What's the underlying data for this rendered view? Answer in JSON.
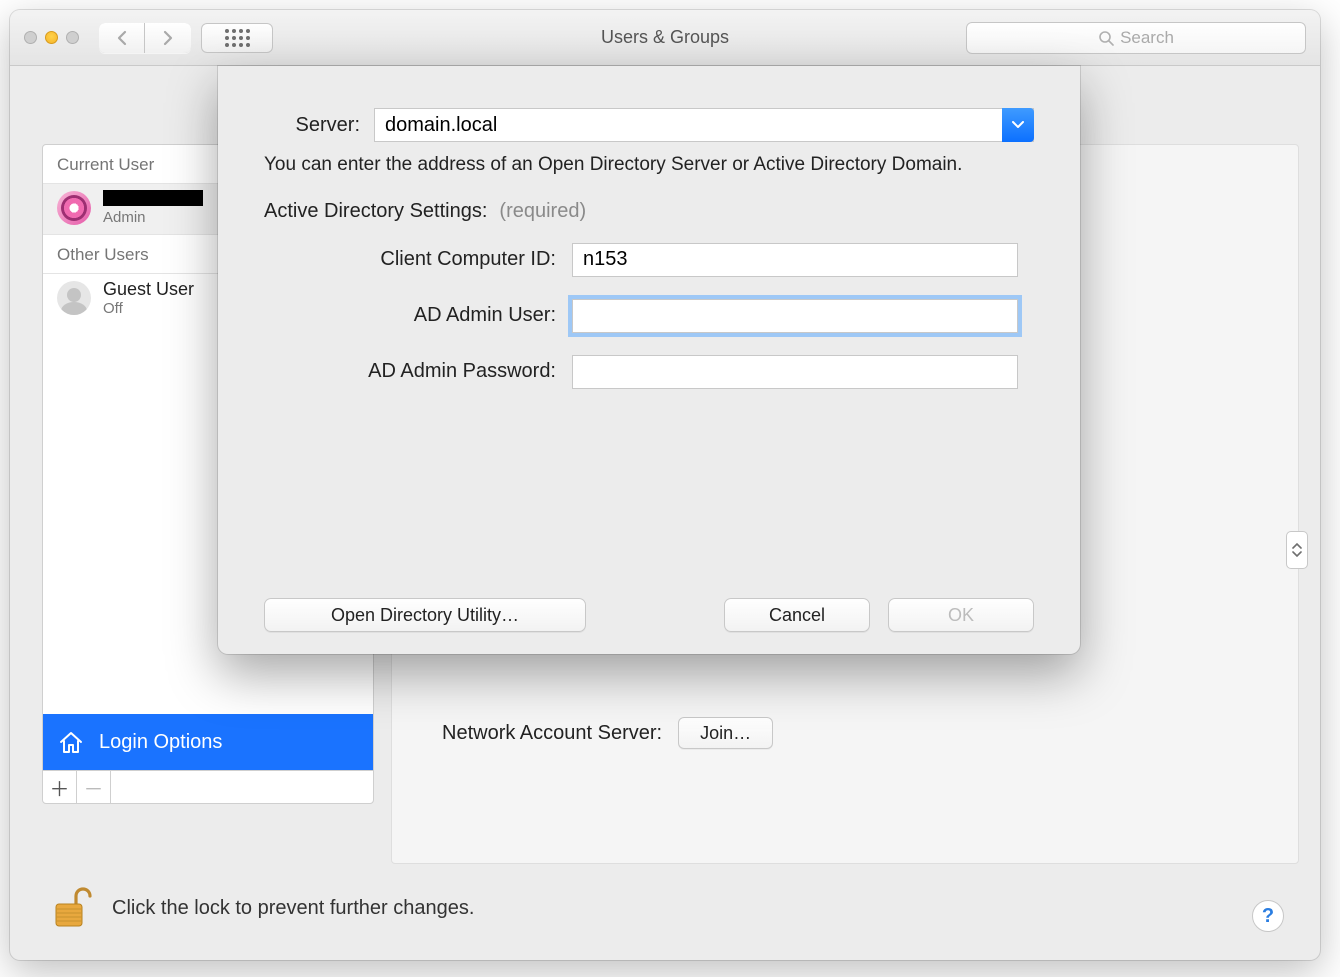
{
  "window": {
    "title": "Users & Groups"
  },
  "search": {
    "placeholder": "Search"
  },
  "sidebar": {
    "current_user_label": "Current User",
    "other_users_label": "Other Users",
    "current_role": "Admin",
    "guest_name": "Guest User",
    "guest_status": "Off",
    "login_options": "Login Options"
  },
  "main": {
    "network_label": "Network Account Server:",
    "join_label": "Join…"
  },
  "sheet": {
    "server_label": "Server:",
    "server_value": "domain.local",
    "hint": "You can enter the address of an Open Directory Server or Active Directory Domain.",
    "ad_settings": "Active Directory Settings:",
    "required": "(required)",
    "client_id_label": "Client Computer ID:",
    "client_id_value": "n153",
    "ad_user_label": "AD Admin User:",
    "ad_user_value": "",
    "ad_pass_label": "AD Admin Password:",
    "ad_pass_value": "",
    "open_dir_util": "Open Directory Utility…",
    "cancel": "Cancel",
    "ok": "OK"
  },
  "footer": {
    "lock_text": "Click the lock to prevent further changes."
  }
}
